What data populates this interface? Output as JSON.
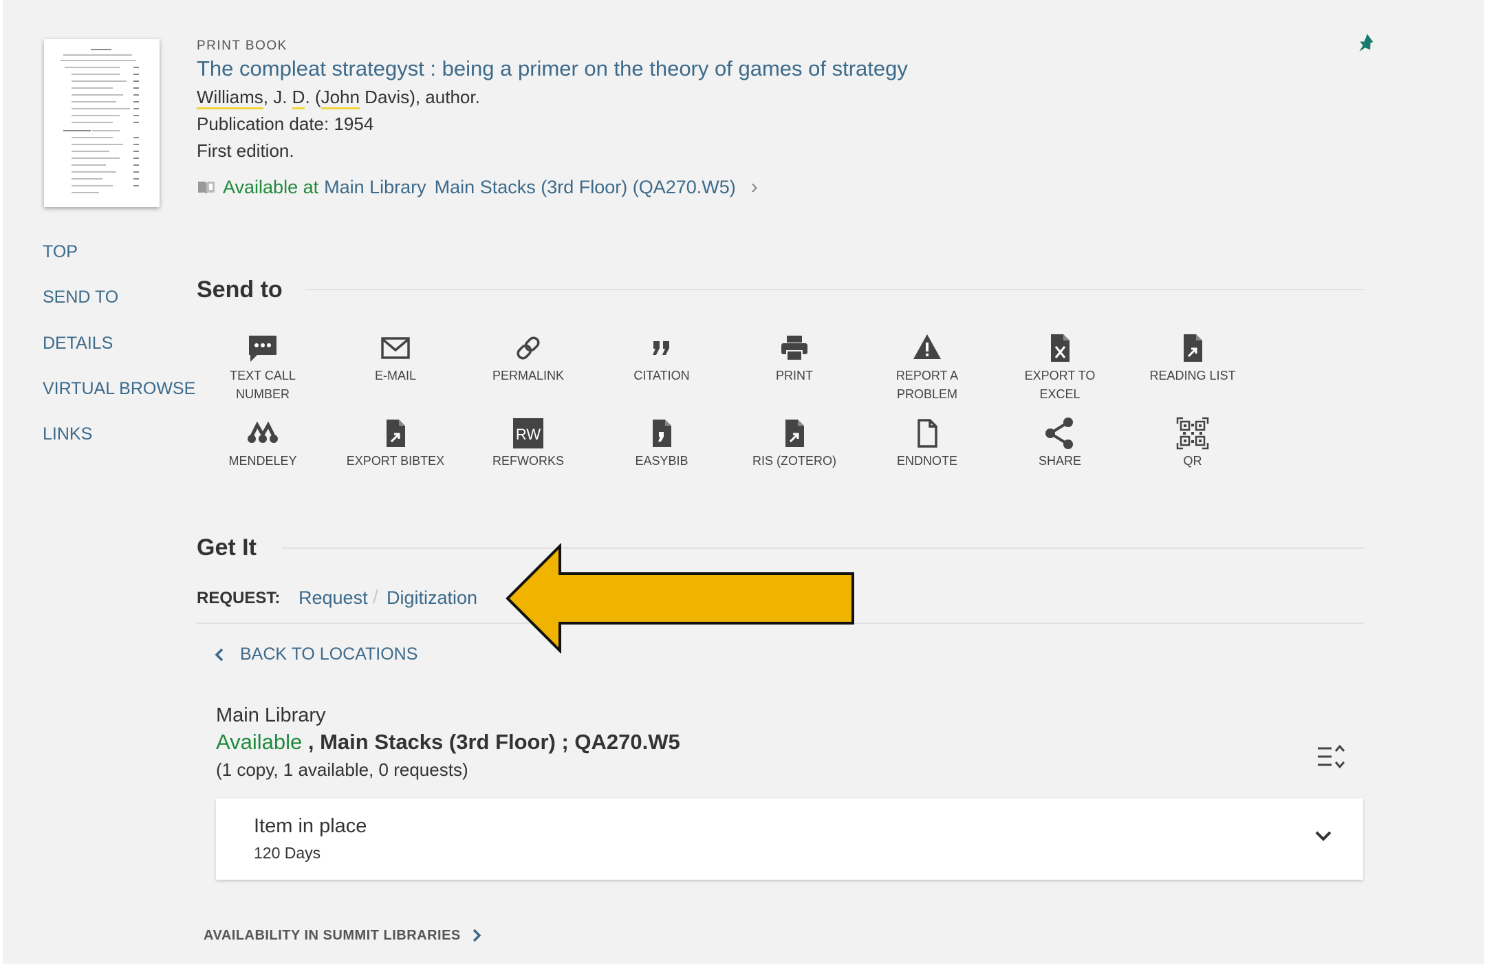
{
  "record": {
    "type": "PRINT BOOK",
    "title": "The compleat strategyst : being a primer on the theory of games of strategy",
    "author_last": "Williams",
    "author_mid": ", J. ",
    "author_d": "D",
    "author_paren_open": ". (",
    "author_john": "John",
    "author_rest": " Davis), author.",
    "publication": "Publication date: 1954",
    "edition": "First edition.",
    "availability_status": "Available at",
    "availability_library": "Main Library",
    "availability_location": "Main Stacks (3rd Floor) (QA270.W5)"
  },
  "nav": {
    "top": "TOP",
    "send_to": "SEND TO",
    "details": "DETAILS",
    "virtual_browse": "VIRTUAL BROWSE",
    "links": "LINKS"
  },
  "send_to": {
    "title": "Send to",
    "items": [
      {
        "label_1": "TEXT CALL",
        "label_2": "NUMBER",
        "icon": "message-icon"
      },
      {
        "label_1": "E-MAIL",
        "label_2": "",
        "icon": "envelope-icon"
      },
      {
        "label_1": "PERMALINK",
        "label_2": "",
        "icon": "link-icon"
      },
      {
        "label_1": "CITATION",
        "label_2": "",
        "icon": "quote-icon"
      },
      {
        "label_1": "PRINT",
        "label_2": "",
        "icon": "printer-icon"
      },
      {
        "label_1": "REPORT A",
        "label_2": "PROBLEM",
        "icon": "warning-icon"
      },
      {
        "label_1": "EXPORT TO",
        "label_2": "EXCEL",
        "icon": "excel-file-icon"
      },
      {
        "label_1": "READING LIST",
        "label_2": "",
        "icon": "file-export-icon"
      },
      {
        "label_1": "MENDELEY",
        "label_2": "",
        "icon": "mendeley-icon"
      },
      {
        "label_1": "EXPORT BIBTEX",
        "label_2": "",
        "icon": "file-export-icon"
      },
      {
        "label_1": "REFWORKS",
        "label_2": "",
        "icon": "refworks-icon",
        "badge": "RW"
      },
      {
        "label_1": "EASYBIB",
        "label_2": "",
        "icon": "easybib-icon"
      },
      {
        "label_1": "RIS (ZOTERO)",
        "label_2": "",
        "icon": "file-export-icon"
      },
      {
        "label_1": "ENDNOTE",
        "label_2": "",
        "icon": "file-outline-icon"
      },
      {
        "label_1": "SHARE",
        "label_2": "",
        "icon": "share-icon"
      },
      {
        "label_1": "QR",
        "label_2": "",
        "icon": "qr-code-icon"
      }
    ]
  },
  "get_it": {
    "title": "Get It",
    "request_label": "REQUEST:",
    "request_link": "Request",
    "separator": "/",
    "digitization_link": "Digitization",
    "back_label": "BACK TO LOCATIONS",
    "location_library": "Main Library",
    "location_status": "Available",
    "location_detail": " , Main Stacks (3rd Floor) ; QA270.W5",
    "location_counts": "(1 copy, 1 available, 0 requests)",
    "item_status": "Item in place",
    "item_loan": "120 Days",
    "summit_label": "AVAILABILITY IN SUMMIT LIBRARIES"
  },
  "colors": {
    "link": "#3c6a8b",
    "available": "#1f8a3b",
    "arrow_fill": "#f0b400",
    "pin": "#1a7a6e"
  }
}
